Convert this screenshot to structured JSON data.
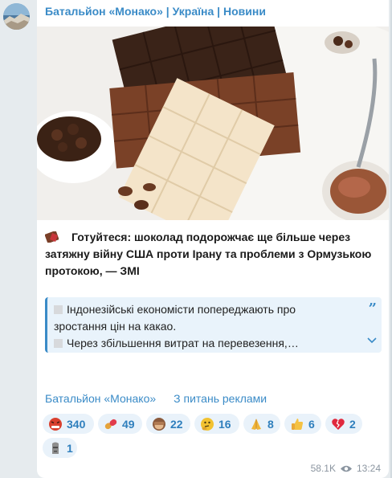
{
  "channel": {
    "title": "Батальйон «Монако» | Україна | Новини"
  },
  "post": {
    "caption": "Готуйтеся: шоколад подорожчає ще більше через затяжну війну США проти Ірану та проблеми з Ормузькою протокою, — ЗМІ",
    "quote": {
      "line1": "Індонезійські економісти попереджають про",
      "line2": "зростання цін на какао.",
      "line3": "Через збільшення витрат на перевезення,…"
    },
    "links": [
      {
        "label": "Батальйон «Монако»"
      },
      {
        "label": "З питань реклами"
      }
    ]
  },
  "reactions": [
    {
      "icon": "angry-face-icon",
      "count": "340"
    },
    {
      "icon": "pill-icon",
      "count": "49"
    },
    {
      "icon": "see-no-evil-monkey-icon",
      "count": "22"
    },
    {
      "icon": "thinking-face-icon",
      "count": "16"
    },
    {
      "icon": "praying-hands-icon",
      "count": "8"
    },
    {
      "icon": "thumbs-up-icon",
      "count": "6"
    },
    {
      "icon": "broken-heart-icon",
      "count": "2"
    },
    {
      "icon": "moai-icon",
      "count": "1"
    }
  ],
  "meta": {
    "views": "58.1K",
    "time": "13:24"
  }
}
